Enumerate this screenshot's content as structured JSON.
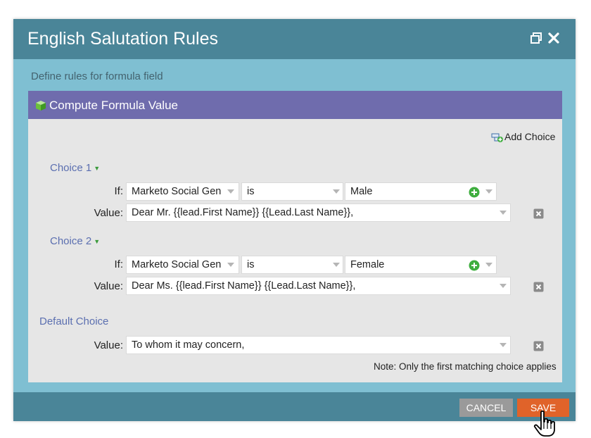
{
  "dialog": {
    "title": "English Salutation Rules",
    "subtitle": "Define rules for formula field"
  },
  "panel": {
    "title": "Compute Formula Value",
    "add_choice_label": "Add Choice"
  },
  "labels": {
    "if": "If:",
    "value": "Value:"
  },
  "choices": [
    {
      "label": "Choice 1",
      "field": "Marketo Social Gen",
      "operator": "is",
      "match_value": "Male",
      "value": "Dear Mr. {{lead.First Name}} {{Lead.Last Name}},"
    },
    {
      "label": "Choice 2",
      "field": "Marketo Social Gen",
      "operator": "is",
      "match_value": "Female",
      "value": "Dear Ms. {{lead.First Name}} {{Lead.Last Name}},"
    }
  ],
  "default_choice": {
    "label": "Default Choice",
    "value": "To whom it may concern,"
  },
  "note": "Note: Only the first matching choice applies",
  "footer": {
    "cancel_label": "CANCEL",
    "save_label": "SAVE"
  },
  "colors": {
    "titlebar": "#4a8598",
    "dialog_bg": "#7fbfd2",
    "panel_header": "#6f6cad",
    "panel_bg": "#e6e6e6",
    "choice_label": "#5b6fb0",
    "save": "#e0632a",
    "cancel": "#9a9a9a"
  },
  "icons": [
    "restore-icon",
    "close-icon",
    "cube-icon",
    "add-choice-icon",
    "plus-icon",
    "remove-icon",
    "chevron-down-icon",
    "hand-cursor-icon"
  ]
}
